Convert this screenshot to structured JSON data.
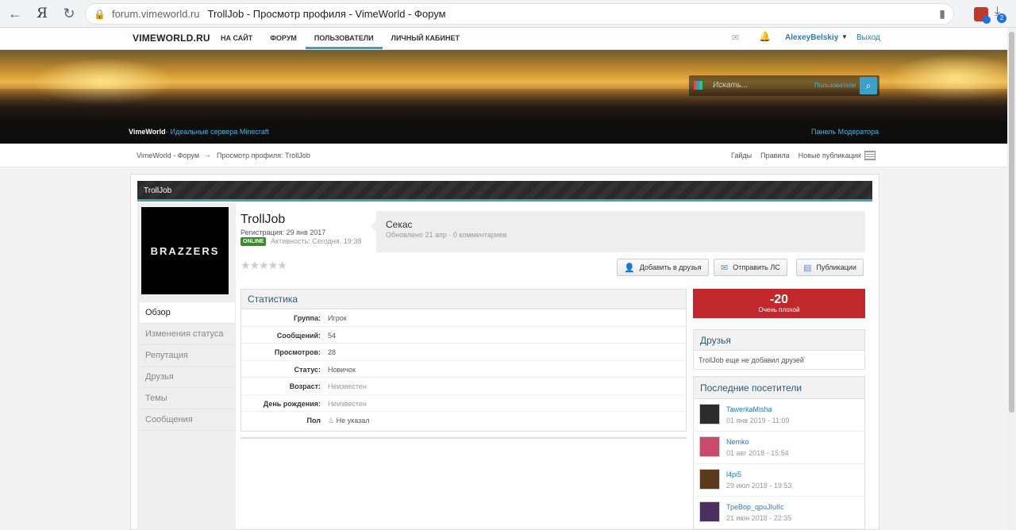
{
  "browser": {
    "url": "forum.vimeworld.ru",
    "title": "TrollJob - Просмотр профиля - VimeWorld - Форум",
    "download_badge": "2"
  },
  "topnav": {
    "logo": "VIMEWORLD.RU",
    "items": [
      {
        "label": "НА САЙТ"
      },
      {
        "label": "ФОРУМ"
      },
      {
        "label": "ПОЛЬЗОВАТЕЛИ"
      },
      {
        "label": "ЛИЧНЫЙ КАБИНЕТ"
      }
    ],
    "active_index": 2,
    "username": "AlexeyBelskiy",
    "logout": "Выход"
  },
  "search": {
    "placeholder": "Искать...",
    "scope": "Пользователи"
  },
  "blackbar": {
    "site": "VimeWorld",
    "tagline": " - Идеальные сервера Minecraft",
    "moderator": "Панель Модератора"
  },
  "breadcrumb": {
    "root": "VimeWorld - Форум",
    "arrow": "→",
    "current": "Просмотр профиля: TrollJob",
    "links": [
      "Гайды",
      "Правила",
      "Новые публикации"
    ]
  },
  "profile": {
    "panel_title": "TrollJob",
    "avatar_text": "BRAZZERS",
    "name": "TrollJob",
    "registration": "Регистрация: 29 янв 2017",
    "online_badge": "ONLINE",
    "activity": "Активность: Сегодня, 19:38",
    "stars": "★★★★★",
    "status_text": "Секас",
    "status_meta": "Обновлено 21 апр · 0 комментариев",
    "buttons": {
      "add_friend": "Добавить в друзья",
      "send_pm": "Отправить ЛС",
      "publications": "Публикации"
    },
    "side_nav": [
      "Обзор",
      "Изменения статуса",
      "Репутация",
      "Друзья",
      "Темы",
      "Сообщения"
    ],
    "stats_title": "Статистика",
    "stats": [
      {
        "key": "Группа:",
        "value": "Игрок"
      },
      {
        "key": "Сообщений:",
        "value": "54"
      },
      {
        "key": "Просмотров:",
        "value": "28"
      },
      {
        "key": "Статус:",
        "value": "Новичок"
      },
      {
        "key": "Возраст:",
        "value": "Неизвестен"
      },
      {
        "key": "День рождения:",
        "value": "Неизвестен"
      },
      {
        "key": "Пол",
        "value": "Не указал"
      }
    ],
    "reputation": {
      "value": "-20",
      "label": "Очень плохой",
      "color": "#c0282b"
    },
    "friends_title": "Друзья",
    "friends_text": "TrollJob еще не добавил друзей",
    "visitors_title": "Последние посетители",
    "visitors": [
      {
        "name": "TawerkaMisha",
        "date": "01 янв 2019 - 11:09",
        "color": "#2b2b2b"
      },
      {
        "name": "Nemko",
        "date": "01 авг 2018 - 15:54",
        "color": "#c94a6a"
      },
      {
        "name": "l4pi5",
        "date": "29 июл 2018 - 19:53",
        "color": "#5a3a1a"
      },
      {
        "name": "ТреВор_qpuJIuIIc",
        "date": "21 июн 2018 - 22:35",
        "color": "#4a3060"
      }
    ]
  },
  "colors": {
    "accent": "#3ca1c8",
    "link": "#1f7eb8",
    "online": "#3b8a2b"
  }
}
